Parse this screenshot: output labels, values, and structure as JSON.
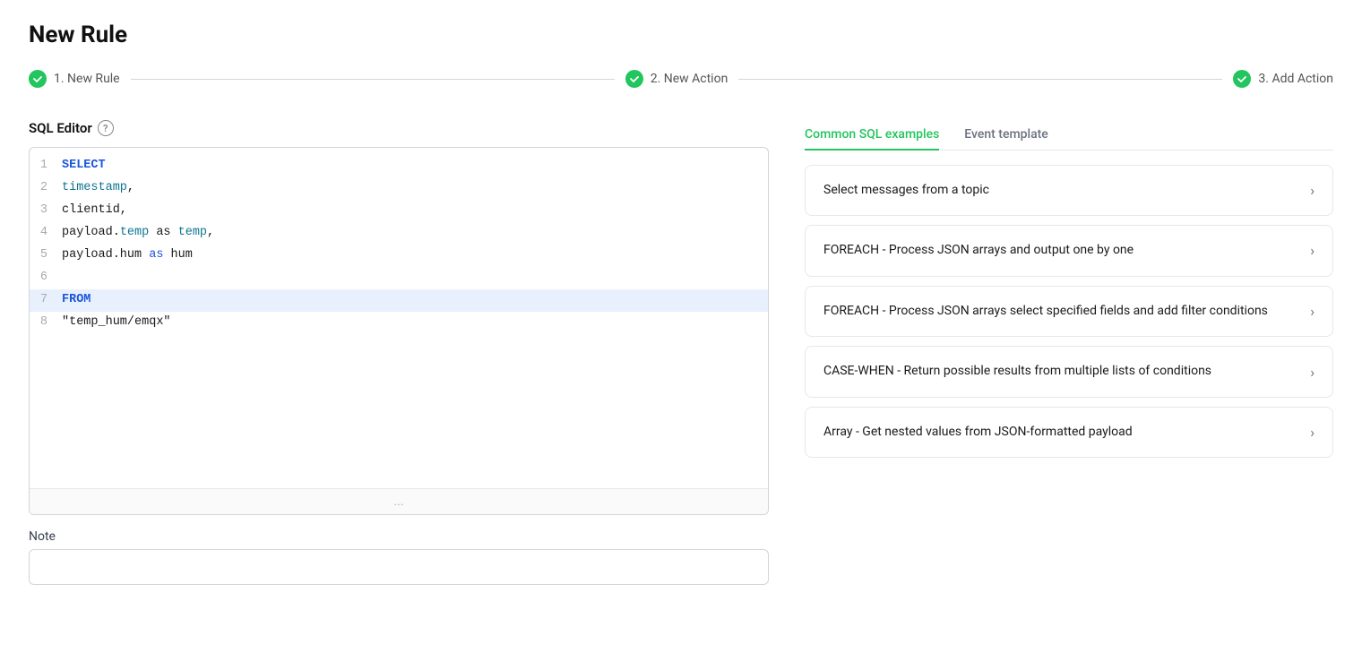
{
  "page": {
    "title": "New Rule"
  },
  "stepper": {
    "steps": [
      {
        "id": "step1",
        "label": "1. New Rule",
        "active": true
      },
      {
        "id": "step2",
        "label": "2. New Action",
        "active": true
      },
      {
        "id": "step3",
        "label": "3. Add Action",
        "active": true
      }
    ]
  },
  "editor": {
    "section_label": "SQL Editor",
    "help_label": "?",
    "lines": [
      {
        "num": "1",
        "tokens": [
          {
            "type": "kw",
            "text": "SELECT"
          }
        ],
        "highlighted": false
      },
      {
        "num": "2",
        "tokens": [
          {
            "type": "indent",
            "text": "    "
          },
          {
            "type": "field",
            "text": "timestamp"
          },
          {
            "type": "str",
            "text": ","
          }
        ],
        "highlighted": false
      },
      {
        "num": "3",
        "tokens": [
          {
            "type": "indent",
            "text": "    "
          },
          {
            "type": "str",
            "text": "clientid,"
          }
        ],
        "highlighted": false
      },
      {
        "num": "4",
        "tokens": [
          {
            "type": "indent",
            "text": "    "
          },
          {
            "type": "str",
            "text": "payload."
          },
          {
            "type": "field",
            "text": "temp"
          },
          {
            "type": "str",
            "text": " as "
          },
          {
            "type": "field",
            "text": "temp"
          },
          {
            "type": "str",
            "text": ","
          }
        ],
        "highlighted": false
      },
      {
        "num": "5",
        "tokens": [
          {
            "type": "indent",
            "text": "    "
          },
          {
            "type": "str",
            "text": "payload.hum "
          },
          {
            "type": "kw2",
            "text": "as"
          },
          {
            "type": "str",
            "text": " hum"
          }
        ],
        "highlighted": false
      },
      {
        "num": "6",
        "tokens": [],
        "highlighted": false
      },
      {
        "num": "7",
        "tokens": [
          {
            "type": "kw",
            "text": "FROM"
          }
        ],
        "highlighted": true
      },
      {
        "num": "8",
        "tokens": [
          {
            "type": "str",
            "text": "\"temp_hum/emqx\""
          }
        ],
        "highlighted": false
      }
    ],
    "footer_dots": "..."
  },
  "note": {
    "label": "Note",
    "placeholder": ""
  },
  "right_panel": {
    "tabs": [
      {
        "id": "common-sql",
        "label": "Common SQL examples",
        "active": true
      },
      {
        "id": "event-template",
        "label": "Event template",
        "active": false
      }
    ],
    "examples": [
      {
        "id": "ex1",
        "text": "Select messages from a topic"
      },
      {
        "id": "ex2",
        "text": "FOREACH - Process JSON arrays and output one by one"
      },
      {
        "id": "ex3",
        "text": "FOREACH - Process JSON arrays select specified fields and add filter conditions"
      },
      {
        "id": "ex4",
        "text": "CASE-WHEN - Return possible results from multiple lists of conditions"
      },
      {
        "id": "ex5",
        "text": "Array - Get nested values from JSON-formatted payload"
      }
    ]
  }
}
